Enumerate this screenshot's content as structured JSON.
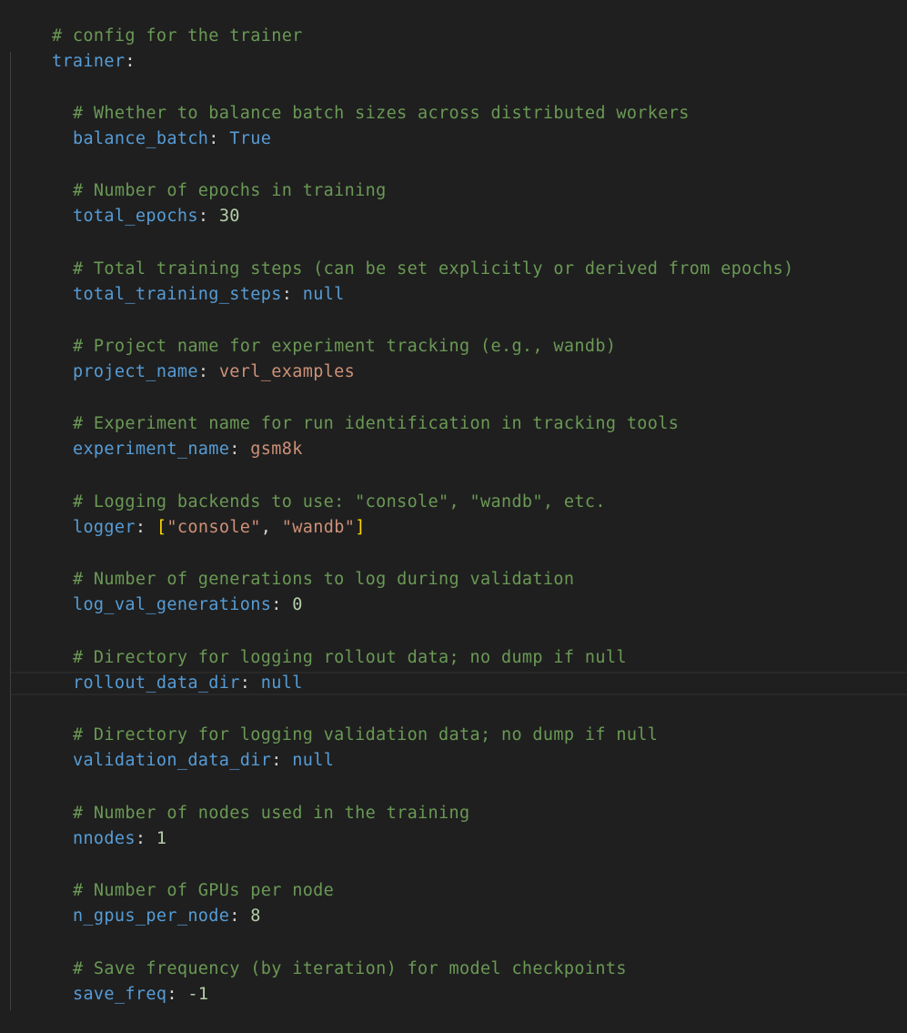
{
  "editor": {
    "header_comment": "# config for the trainer",
    "root_key": "trainer",
    "colon": ":",
    "entries": [
      {
        "comment": "# Whether to balance batch sizes across distributed workers",
        "key": "balance_batch",
        "value": "True"
      },
      {
        "comment": "# Number of epochs in training",
        "key": "total_epochs",
        "value": "30"
      },
      {
        "comment": "# Total training steps (can be set explicitly or derived from epochs)",
        "key": "total_training_steps",
        "value": "null"
      },
      {
        "comment": "# Project name for experiment tracking (e.g., wandb)",
        "key": "project_name",
        "value": "verl_examples"
      },
      {
        "comment": "# Experiment name for run identification in tracking tools",
        "key": "experiment_name",
        "value": "gsm8k"
      },
      {
        "comment": "# Logging backends to use: \"console\", \"wandb\", etc.",
        "key": "logger",
        "value_open": "[",
        "value_items": [
          "\"console\"",
          "\"wandb\""
        ],
        "value_sep": ", ",
        "value_close": "]"
      },
      {
        "comment": "# Number of generations to log during validation",
        "key": "log_val_generations",
        "value": "0"
      },
      {
        "comment": "# Directory for logging rollout data; no dump if null",
        "key": "rollout_data_dir",
        "value": "null"
      },
      {
        "comment": "# Directory for logging validation data; no dump if null",
        "key": "validation_data_dir",
        "value": "null"
      },
      {
        "comment": "# Number of nodes used in the training",
        "key": "nnodes",
        "value": "1"
      },
      {
        "comment": "# Number of GPUs per node",
        "key": "n_gpus_per_node",
        "value": "8"
      },
      {
        "comment": "# Save frequency (by iteration) for model checkpoints",
        "key": "save_freq",
        "value": "-1"
      }
    ]
  }
}
